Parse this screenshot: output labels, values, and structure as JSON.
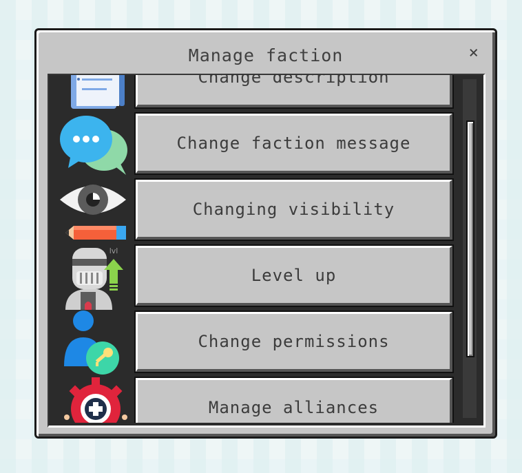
{
  "window": {
    "title": "Manage faction",
    "close_label": "×"
  },
  "items": [
    {
      "label": "Change description",
      "icon": "notepad-icon"
    },
    {
      "label": "Change faction message",
      "icon": "chat-bubbles-icon"
    },
    {
      "label": "Changing visibility",
      "icon": "eye-pencil-icon"
    },
    {
      "label": "Level up",
      "icon": "knight-level-up-icon"
    },
    {
      "label": "Change permissions",
      "icon": "user-key-icon"
    },
    {
      "label": "Manage alliances",
      "icon": "gear-plus-icon"
    }
  ],
  "level_badge": "lvl"
}
